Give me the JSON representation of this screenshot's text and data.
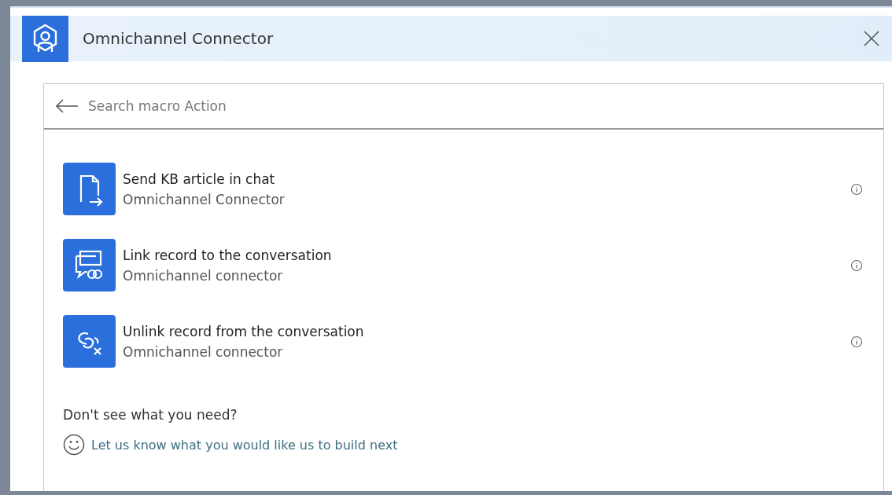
{
  "dialog": {
    "title": "Omnichannel Connector"
  },
  "search": {
    "placeholder": "Search macro Action"
  },
  "actions": [
    {
      "kind": "send-article",
      "title": "Send KB article in chat",
      "subtitle": "Omnichannel Connector"
    },
    {
      "kind": "link",
      "title": "Link record to the conversation",
      "subtitle": "Omnichannel connector"
    },
    {
      "kind": "unlink",
      "title": "Unlink record from the conversation",
      "subtitle": "Omnichannel connector"
    }
  ],
  "footer": {
    "prompt": "Don't see what you need?",
    "link": "Let us know what you would like us to build next"
  }
}
